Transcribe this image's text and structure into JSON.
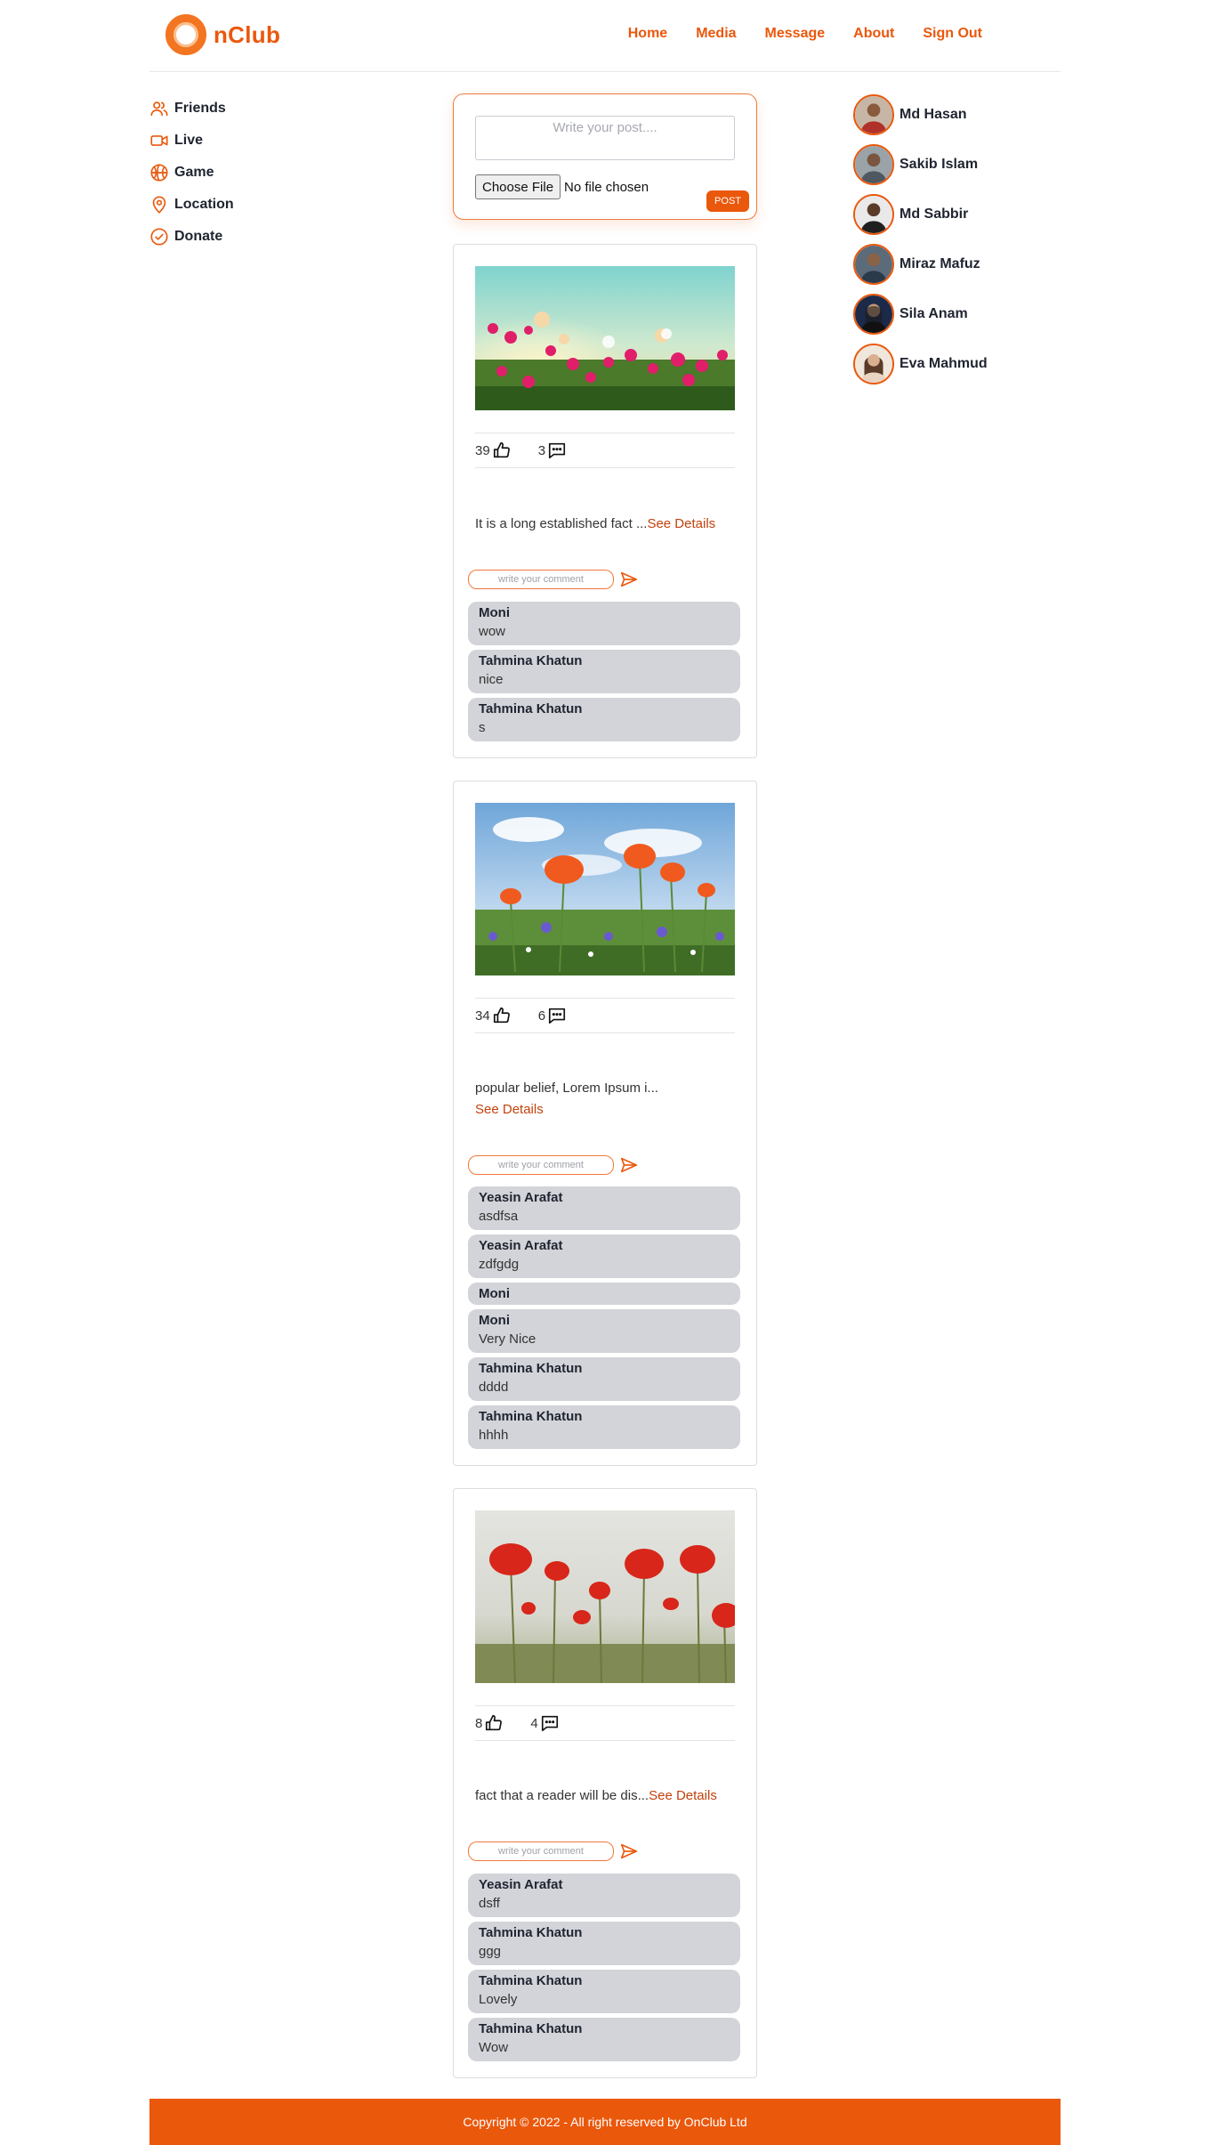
{
  "header": {
    "logo_text": "nClub",
    "nav": [
      "Home",
      "Media",
      "Message",
      "About",
      "Sign Out"
    ]
  },
  "left_nav": [
    {
      "label": "Friends",
      "icon": "users-icon"
    },
    {
      "label": "Live",
      "icon": "video-icon"
    },
    {
      "label": "Game",
      "icon": "basketball-icon"
    },
    {
      "label": "Location",
      "icon": "map-pin-icon"
    },
    {
      "label": "Donate",
      "icon": "check-circle-icon"
    }
  ],
  "composer": {
    "placeholder": "Write your post....",
    "file_button": "Choose File",
    "file_status": "No file chosen",
    "post_button": "POST"
  },
  "posts": [
    {
      "likes": "39",
      "comments_count": "3",
      "excerpt": "It is a long established fact ...",
      "see_details": "See Details",
      "comment_placeholder": "write your comment",
      "comments": [
        {
          "name": "Moni",
          "text": "wow"
        },
        {
          "name": "Tahmina Khatun",
          "text": "nice"
        },
        {
          "name": "Tahmina Khatun",
          "text": "s"
        }
      ]
    },
    {
      "likes": "34",
      "comments_count": "6",
      "excerpt": "popular belief, Lorem Ipsum i...",
      "see_details": "See Details",
      "comment_placeholder": "write your comment",
      "comments": [
        {
          "name": "Yeasin Arafat",
          "text": "asdfsa"
        },
        {
          "name": "Yeasin Arafat",
          "text": "zdfgdg"
        },
        {
          "name": "Moni",
          "text": ""
        },
        {
          "name": "Moni",
          "text": "Very Nice"
        },
        {
          "name": "Tahmina Khatun",
          "text": "dddd"
        },
        {
          "name": "Tahmina Khatun",
          "text": "hhhh"
        }
      ]
    },
    {
      "likes": "8",
      "comments_count": "4",
      "excerpt": "fact that a reader will be dis...",
      "see_details": "See Details",
      "comment_placeholder": "write your comment",
      "comments": [
        {
          "name": "Yeasin Arafat",
          "text": "dsff"
        },
        {
          "name": "Tahmina Khatun",
          "text": "ggg"
        },
        {
          "name": "Tahmina Khatun",
          "text": "Lovely"
        },
        {
          "name": "Tahmina Khatun",
          "text": "Wow"
        }
      ]
    }
  ],
  "people": [
    {
      "name": "Md Hasan"
    },
    {
      "name": "Sakib Islam"
    },
    {
      "name": "Md Sabbir"
    },
    {
      "name": "Miraz Mafuz"
    },
    {
      "name": "Sila Anam"
    },
    {
      "name": "Eva Mahmud"
    }
  ],
  "footer": {
    "text": "Copyright © 2022 - All right reserved by OnClub Ltd"
  },
  "colors": {
    "accent": "#ea580c",
    "comment_bg": "#d2d4d9"
  }
}
